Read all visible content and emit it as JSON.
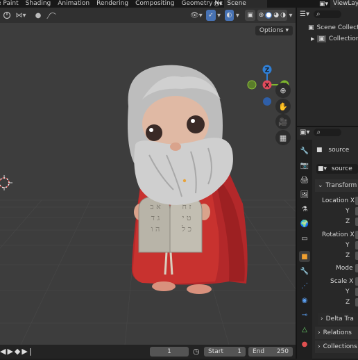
{
  "topbar": {
    "tabs": [
      "e Paint",
      "Shading",
      "Animation",
      "Rendering",
      "Compositing",
      "Geometry Nc"
    ],
    "scene": "Scene",
    "view_layer": "ViewLaye"
  },
  "viewport": {
    "options_label": "Options",
    "gizmo": {
      "x": "X",
      "y": "Y",
      "z": "Z"
    }
  },
  "timeline": {
    "current_frame": "1",
    "start_label": "Start",
    "start_value": "1",
    "end_label": "End",
    "end_value": "250"
  },
  "outliner": {
    "scene_collection": "Scene Collectio",
    "collection": "Collection"
  },
  "properties": {
    "object_name": "source",
    "mesh_name": "source",
    "transform_label": "Transform",
    "location_label": "Location X",
    "rotation_label": "Rotation X",
    "mode_label": "Mode",
    "scale_label": "Scale X",
    "axis_y": "Y",
    "axis_z": "Z",
    "delta_label": "Delta Tra",
    "relations_label": "Relations",
    "collections_label": "Collections"
  },
  "tablets": {
    "left": "א ב\nג ד\nה ו",
    "right": "ז ח\nט י\nכ ל"
  }
}
